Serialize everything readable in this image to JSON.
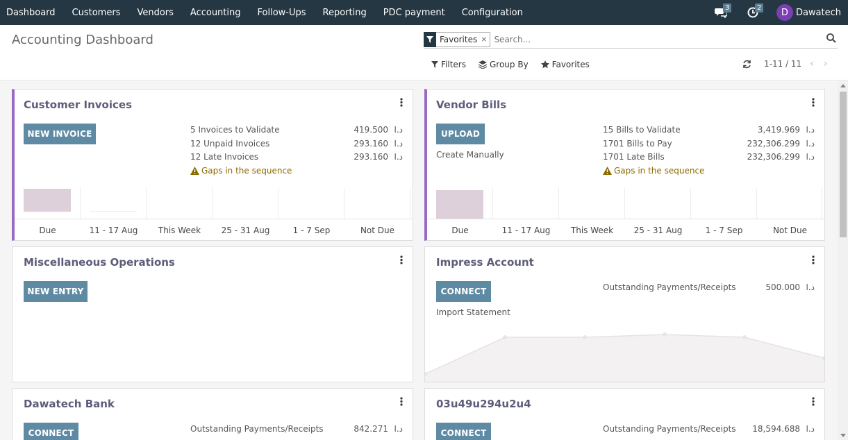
{
  "nav": {
    "items": [
      "Dashboard",
      "Customers",
      "Vendors",
      "Accounting",
      "Follow-Ups",
      "Reporting",
      "PDC payment",
      "Configuration"
    ],
    "messages_count": "3",
    "activities_count": "2",
    "user_initial": "D",
    "user_name": "Dawatech"
  },
  "control": {
    "title": "Accounting Dashboard",
    "facet": "Favorites",
    "facet_remove": "×",
    "search_placeholder": "Search...",
    "filters": "Filters",
    "group_by": "Group By",
    "favorites": "Favorites",
    "pager": "1-11 / 11"
  },
  "cards": {
    "customer_invoices": {
      "title": "Customer Invoices",
      "button": "NEW INVOICE",
      "stats": [
        {
          "label": "5 Invoices to Validate",
          "amount": "419.500",
          "currency": "د.ا"
        },
        {
          "label": "12 Unpaid Invoices",
          "amount": "293.160",
          "currency": "د.ا"
        },
        {
          "label": "12 Late Invoices",
          "amount": "293.160",
          "currency": "د.ا"
        }
      ],
      "warning": "Gaps in the sequence",
      "graph_labels": [
        "Due",
        "11 - 17 Aug",
        "This Week",
        "25 - 31 Aug",
        "1 - 7 Sep",
        "Not Due"
      ]
    },
    "vendor_bills": {
      "title": "Vendor Bills",
      "button": "UPLOAD",
      "link": "Create Manually",
      "stats": [
        {
          "label": "15 Bills to Validate",
          "amount": "3,419.969",
          "currency": "د.ا"
        },
        {
          "label": "1701 Bills to Pay",
          "amount": "232,306.299",
          "currency": "د.ا"
        },
        {
          "label": "1701 Late Bills",
          "amount": "232,306.299",
          "currency": "د.ا"
        }
      ],
      "warning": "Gaps in the sequence",
      "graph_labels": [
        "Due",
        "11 - 17 Aug",
        "This Week",
        "25 - 31 Aug",
        "1 - 7 Sep",
        "Not Due"
      ]
    },
    "misc": {
      "title": "Miscellaneous Operations",
      "button": "NEW ENTRY"
    },
    "impress": {
      "title": "Impress Account",
      "button": "CONNECT",
      "link": "Import Statement",
      "outstanding_label": "Outstanding Payments/Receipts",
      "outstanding_amount": "500.000",
      "currency": "د.ا"
    },
    "dawatech_bank": {
      "title": "Dawatech Bank",
      "button": "CONNECT",
      "outstanding_label": "Outstanding Payments/Receipts",
      "outstanding_amount": "842.271",
      "currency": "د.ا"
    },
    "other": {
      "title": "03u49u294u2u4",
      "button": "CONNECT",
      "outstanding_label": "Outstanding Payments/Receipts",
      "outstanding_amount": "18,594.688",
      "currency": "د.ا"
    }
  },
  "colors": {
    "navbar": "#243742",
    "button": "#5f8aa4",
    "journal_accent": "#9a6ac3",
    "graph_bar": "#ddd0db",
    "warning": "#8b6b00"
  }
}
